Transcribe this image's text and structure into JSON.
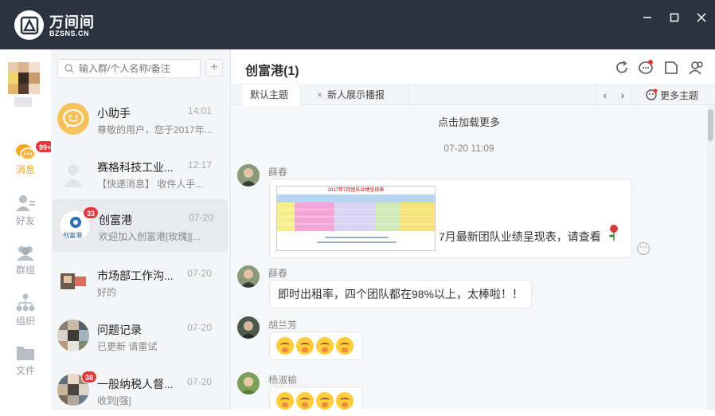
{
  "app": {
    "name": "万间间",
    "site": "BZSNS.CN"
  },
  "window": {
    "minimize": "—",
    "maximize": "□",
    "close": "✕"
  },
  "nav": {
    "items": [
      {
        "label": "消息",
        "badge": "99+"
      },
      {
        "label": "好友"
      },
      {
        "label": "群组"
      },
      {
        "label": "组织"
      },
      {
        "label": "文件"
      }
    ]
  },
  "search": {
    "placeholder": "输入群/个人名称/备注",
    "add": "+"
  },
  "conversations": [
    {
      "name": "小助手",
      "time": "14:01",
      "preview": "尊敬的用户，您于2017年..."
    },
    {
      "name": "赛格科技工业...",
      "time": "12:17",
      "preview": "【快递消息】 收件人手..."
    },
    {
      "name": "创富港",
      "time": "07-20",
      "preview": "欢迎加入创富港[玫瑰][...",
      "badge": "33",
      "avatar_text": "创富港"
    },
    {
      "name": "市场部工作沟...",
      "time": "07-20",
      "preview": "好的"
    },
    {
      "name": "问题记录",
      "time": "07-20",
      "preview": "已更新 请重试"
    },
    {
      "name": "一般纳税人督...",
      "time": "07-20",
      "preview": "收到[强]",
      "badge": "38"
    }
  ],
  "chat": {
    "title": "创富港(1)",
    "tabs": [
      "默认主题",
      "新人展示播报"
    ],
    "tab_close": "×",
    "more_topics": "更多主题",
    "load_more": "点击加载更多",
    "timestamp": "07-20 11:09",
    "image_title": "2017年7月团队业绩呈现表",
    "messages": [
      {
        "sender": "薛春",
        "text": "7月最新团队业绩呈现表，请查看"
      },
      {
        "sender": "薛春",
        "text": "即时出租率，四个团队都在98%以上，太棒啦！！"
      },
      {
        "sender": "胡兰芳",
        "text": ""
      },
      {
        "sender": "杨淑榆",
        "text": ""
      }
    ]
  },
  "colors": {
    "titlebar": "#2b3341",
    "accent": "#f5a623",
    "badge": "#e5383b"
  }
}
